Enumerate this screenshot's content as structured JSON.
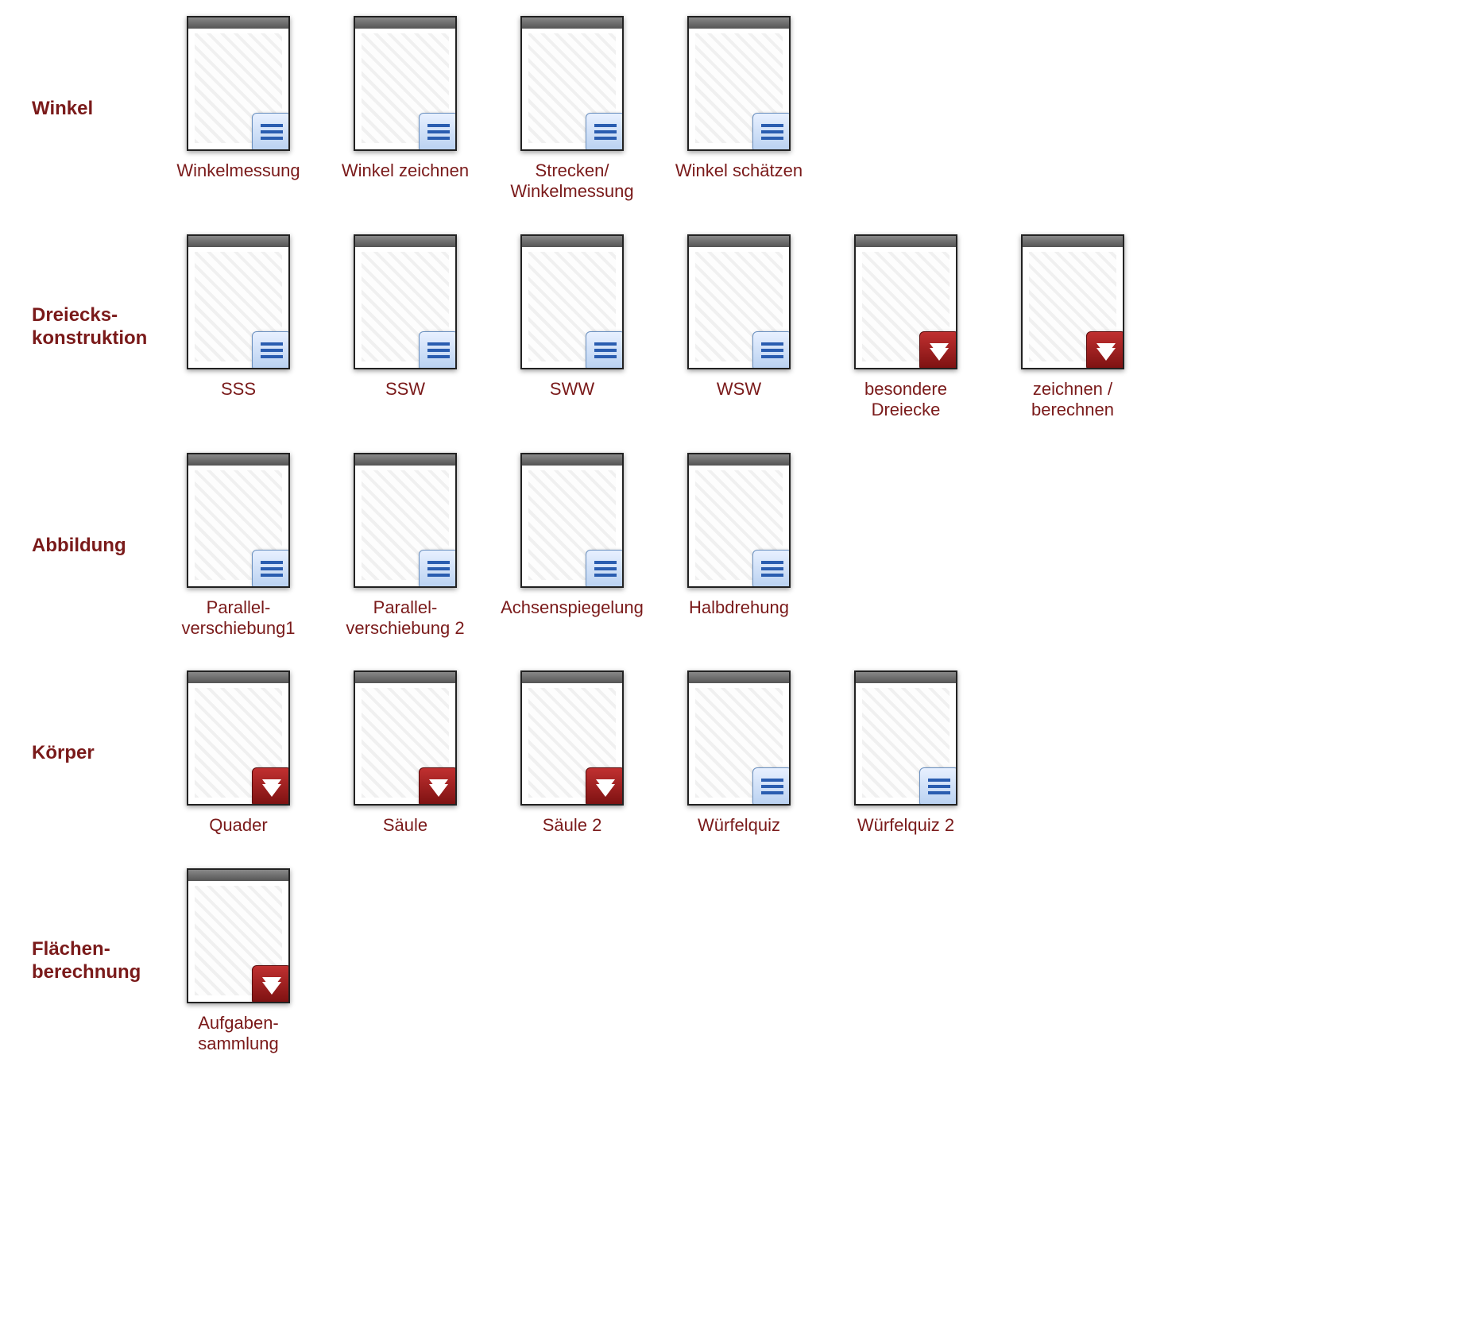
{
  "colors": {
    "text": "#7a1a1a",
    "bg": "#ffffff"
  },
  "rows": [
    {
      "label": "Winkel",
      "items": [
        {
          "caption": "Winkelmessung",
          "type": "word"
        },
        {
          "caption": "Winkel zeichnen",
          "type": "word"
        },
        {
          "caption": "Strecken/\nWinkelmessung",
          "type": "word"
        },
        {
          "caption": "Winkel schätzen",
          "type": "word"
        }
      ]
    },
    {
      "label": "Dreiecks-\nkonstruktion",
      "items": [
        {
          "caption": "SSS",
          "type": "word"
        },
        {
          "caption": "SSW",
          "type": "word"
        },
        {
          "caption": "SWW",
          "type": "word"
        },
        {
          "caption": "WSW",
          "type": "word"
        },
        {
          "caption": "besondere\nDreiecke",
          "type": "pdf"
        },
        {
          "caption": "zeichnen /\nberechnen",
          "type": "pdf"
        }
      ]
    },
    {
      "label": "Abbildung",
      "items": [
        {
          "caption": "Parallel-\nverschiebung1",
          "type": "word"
        },
        {
          "caption": "Parallel-\nverschiebung 2",
          "type": "word"
        },
        {
          "caption": "Achsenspiegelung",
          "type": "word"
        },
        {
          "caption": "Halbdrehung",
          "type": "word"
        }
      ]
    },
    {
      "label": "Körper",
      "items": [
        {
          "caption": "Quader",
          "type": "pdf"
        },
        {
          "caption": "Säule",
          "type": "pdf"
        },
        {
          "caption": "Säule 2",
          "type": "pdf"
        },
        {
          "caption": "Würfelquiz",
          "type": "word"
        },
        {
          "caption": "Würfelquiz 2",
          "type": "word"
        }
      ]
    },
    {
      "label": "Flächen-\nberechnung",
      "items": [
        {
          "caption": "Aufgaben-\nsammlung",
          "type": "pdf"
        }
      ]
    }
  ]
}
